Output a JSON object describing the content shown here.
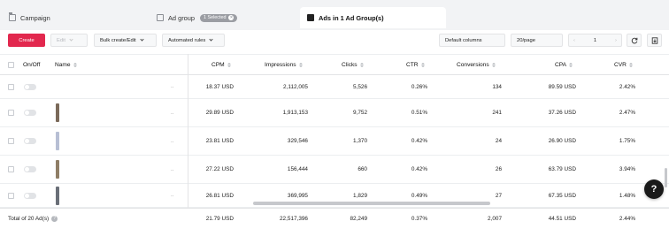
{
  "tabs": {
    "campaign": "Campaign",
    "ad_group": "Ad group",
    "selected_badge": "1 Selected",
    "ads": "Ads in 1 Ad Group(s)"
  },
  "toolbar": {
    "create": "Create",
    "edit": "Edit",
    "bulk": "Bulk create/Edit",
    "automated": "Automated rules",
    "columns": "Default columns",
    "page_size": "20/page",
    "page_number": "1"
  },
  "columns": {
    "onoff": "On/Off",
    "name": "Name",
    "cpm": "CPM",
    "impressions": "Impressions",
    "clicks": "Clicks",
    "ctr": "CTR",
    "conversions": "Conversions",
    "cpa": "CPA",
    "cvr": "CVR"
  },
  "rows": [
    {
      "dots": "..",
      "cpm": "18.37",
      "cpm_unit": "USD",
      "impressions": "2,112,005",
      "clicks": "5,526",
      "ctr": "0.26%",
      "conversions": "134",
      "cpa": "89.59",
      "cpa_unit": "USD",
      "cvr": "2.42%"
    },
    {
      "dots": "..",
      "cpm": "29.89",
      "cpm_unit": "USD",
      "impressions": "1,913,153",
      "clicks": "9,752",
      "ctr": "0.51%",
      "conversions": "241",
      "cpa": "37.26",
      "cpa_unit": "USD",
      "cvr": "2.47%"
    },
    {
      "dots": "..",
      "cpm": "23.81",
      "cpm_unit": "USD",
      "impressions": "329,546",
      "clicks": "1,370",
      "ctr": "0.42%",
      "conversions": "24",
      "cpa": "26.90",
      "cpa_unit": "USD",
      "cvr": "1.75%"
    },
    {
      "dots": "..",
      "cpm": "27.22",
      "cpm_unit": "USD",
      "impressions": "156,444",
      "clicks": "660",
      "ctr": "0.42%",
      "conversions": "26",
      "cpa": "63.79",
      "cpa_unit": "USD",
      "cvr": "3.94%"
    },
    {
      "dots": "..",
      "cpm": "26.81",
      "cpm_unit": "USD",
      "impressions": "369,995",
      "clicks": "1,829",
      "ctr": "0.49%",
      "conversions": "27",
      "cpa": "67.35",
      "cpa_unit": "USD",
      "cvr": "1.48%"
    }
  ],
  "total": {
    "label": "Total of 20 Ad(s)",
    "cpm": "21.79",
    "cpm_unit": "USD",
    "impressions": "22,517,396",
    "clicks": "82,249",
    "ctr": "0.37%",
    "conversions": "2,007",
    "cpa": "44.51",
    "cpa_unit": "USD",
    "cvr": "2.44%"
  },
  "colors": {
    "accent": "#e2284e",
    "tab_bar": "#f2f3f5"
  },
  "icons": [
    "folder-icon",
    "ad-group-icon",
    "ad-document-icon",
    "refresh-icon",
    "export-icon",
    "help-icon",
    "sort-icon"
  ]
}
